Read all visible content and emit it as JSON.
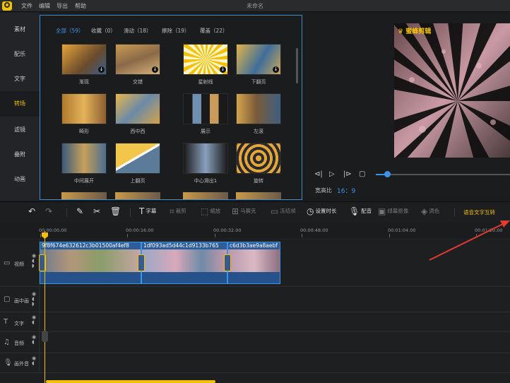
{
  "app": {
    "title": "未命名",
    "menu": [
      "文件",
      "编辑",
      "导出",
      "帮助"
    ]
  },
  "sidebar": {
    "items": [
      {
        "label": "素材",
        "active": false
      },
      {
        "label": "配乐",
        "active": false
      },
      {
        "label": "文字",
        "active": false
      },
      {
        "label": "转场",
        "active": true
      },
      {
        "label": "滤镜",
        "active": false
      },
      {
        "label": "叠附",
        "active": false
      },
      {
        "label": "动画",
        "active": false
      }
    ]
  },
  "panel": {
    "tabs": [
      {
        "label": "全部（59）",
        "active": true
      },
      {
        "label": "收藏（0）",
        "active": false
      },
      {
        "label": "滑动（18）",
        "active": false
      },
      {
        "label": "擦除（19）",
        "active": false
      },
      {
        "label": "覆盖（22）",
        "active": false
      }
    ],
    "transitions": [
      {
        "label": "渐现",
        "download": true
      },
      {
        "label": "交错",
        "download": true
      },
      {
        "label": "星射线",
        "download": true
      },
      {
        "label": "下翻页",
        "download": true
      },
      {
        "label": "畸形",
        "download": false
      },
      {
        "label": "西中西",
        "download": false
      },
      {
        "label": "展示",
        "download": false
      },
      {
        "label": "左滚",
        "download": false
      },
      {
        "label": "中间展开",
        "download": false
      },
      {
        "label": "上翻页",
        "download": false
      },
      {
        "label": "中心滑出1",
        "download": false
      },
      {
        "label": "旋转",
        "download": false
      }
    ]
  },
  "preview": {
    "watermark": "蜜蜂剪辑",
    "controls": [
      "prev-frame",
      "play",
      "next-frame",
      "stop"
    ],
    "progress": 0.08,
    "ratio_label": "宽高比",
    "ratio_value": "16：9"
  },
  "toolbar": {
    "items": [
      {
        "label": "",
        "icon": "undo-icon",
        "enabled": true
      },
      {
        "label": "",
        "icon": "redo-icon",
        "enabled": false
      },
      {
        "label": "",
        "icon": "pencil-icon",
        "enabled": true
      },
      {
        "label": "",
        "icon": "scissors-icon",
        "enabled": true
      },
      {
        "label": "",
        "icon": "trash-icon",
        "enabled": true
      },
      {
        "label": "字幕",
        "icon": "subtitle-icon",
        "enabled": true
      },
      {
        "label": "裁剪",
        "icon": "crop-icon",
        "enabled": false
      },
      {
        "label": "缩放",
        "icon": "zoom-icon",
        "enabled": false
      },
      {
        "label": "马赛克",
        "icon": "mosaic-icon",
        "enabled": false
      },
      {
        "label": "冻结帧",
        "icon": "freeze-icon",
        "enabled": false
      },
      {
        "label": "设置时长",
        "icon": "clock-icon",
        "enabled": true
      },
      {
        "label": "配音",
        "icon": "mic-icon",
        "enabled": true
      },
      {
        "label": "绿幕抠像",
        "icon": "greenscreen-icon",
        "enabled": false
      },
      {
        "label": "调色",
        "icon": "palette-icon",
        "enabled": false
      }
    ],
    "speech_to_text": "语音文字互转"
  },
  "timeline": {
    "ticks": [
      "00:00:00.00",
      "00:00:16.00",
      "00:00:32.00",
      "00:00:48.00",
      "00:01:04.00",
      "00:01:20.00"
    ],
    "tracks": [
      {
        "label": "视频",
        "icon": "video-icon"
      },
      {
        "label": "画中画",
        "icon": "pip-icon"
      },
      {
        "label": "文字",
        "icon": "text-icon"
      },
      {
        "label": "音频",
        "icon": "music-icon"
      },
      {
        "label": "画外音",
        "icon": "voiceover-icon"
      }
    ],
    "clips": [
      {
        "name": "9f8f674e632612c3b01500af4ef8"
      },
      {
        "name": "1df093ad5d44c1d9133b765"
      },
      {
        "name": "c6d3b3ae9a8aebf"
      }
    ]
  }
}
